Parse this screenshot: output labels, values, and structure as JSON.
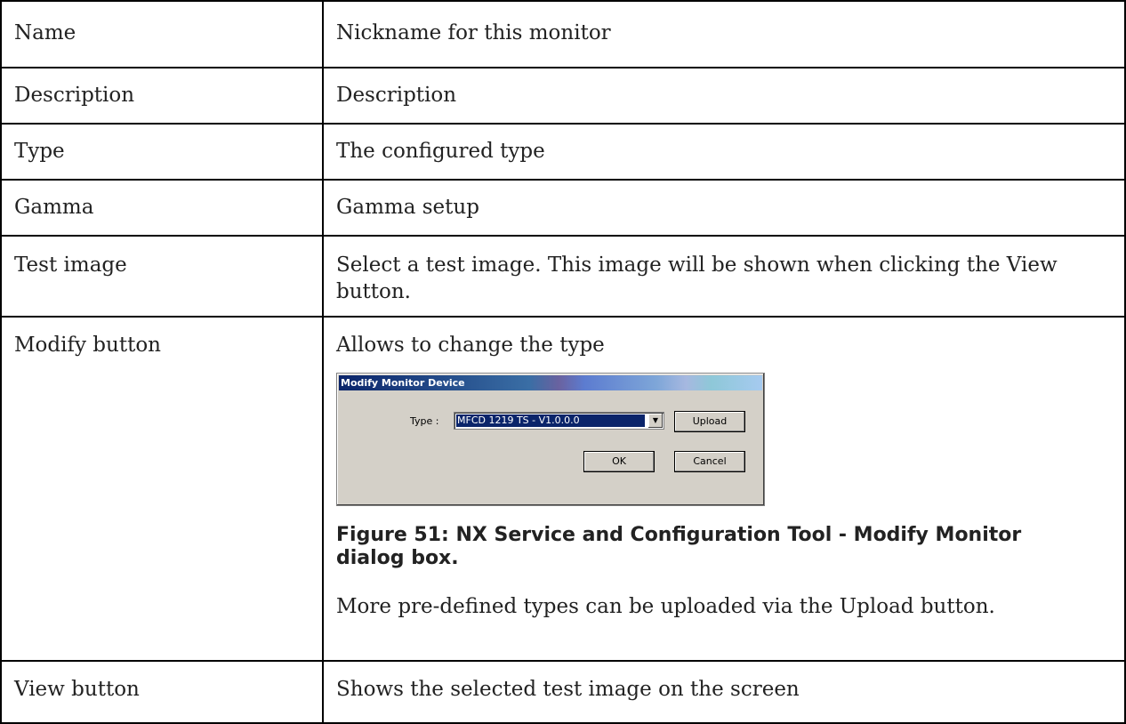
{
  "rows": [
    {
      "label": "Name",
      "value": "Nickname for this monitor"
    },
    {
      "label": "Description",
      "value": "Description"
    },
    {
      "label": "Type",
      "value": "The configured type"
    },
    {
      "label": "Gamma",
      "value": "Gamma setup"
    },
    {
      "label": "Test image",
      "value": "Select a test image. This image will be shown when clicking the View button."
    },
    {
      "label": "Modify button",
      "value": "Allows to change the type"
    },
    {
      "label": "View button",
      "value": "Shows the selected test image on the screen"
    }
  ],
  "dialog": {
    "title": "Modify Monitor Device",
    "type_label": "Type :",
    "type_value": "MFCD 1219 TS - V1.0.0.0",
    "upload_label": "Upload",
    "ok_label": "OK",
    "cancel_label": "Cancel"
  },
  "figure_caption": "Figure 51: NX Service and Configuration Tool - Modify Monitor dialog box.",
  "upload_note": "More pre-defined types can be uploaded via the Upload button.",
  "colors": {
    "border": "#000000",
    "dialog_bg": "#d4d0c8",
    "selection": "#0a246a"
  }
}
